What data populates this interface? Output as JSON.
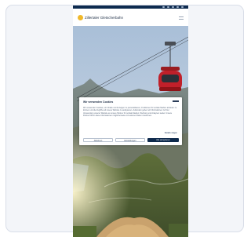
{
  "site": {
    "logo_text": "Zillertaler Gletscherbahn"
  },
  "header": {
    "menu_icon": "hamburger-menu-icon",
    "top_icons": [
      "social-icon",
      "social-icon",
      "social-icon",
      "social-icon",
      "language-icon"
    ]
  },
  "hero": {
    "image": "cable-car-mountain-landscape",
    "cable_car_color": "#c0202a"
  },
  "cookie_banner": {
    "title": "Wir verwenden Cookies",
    "body": "Wir verwenden Cookies, um Inhalte und Anzeigen zu personalisieren, Funktionen für soziale Medien anbieten zu können und die Zugriffe auf unsere Website zu analysieren. Außerdem geben wir Informationen zu Ihrer Verwendung unserer Website an unsere Partner für soziale Medien, Werbung und Analysen weiter. Unsere Partner führen diese Informationen möglicherweise mit weiteren Daten zusammen.",
    "details_link": "Details zeigen",
    "buttons": {
      "decline": "Ablehnen",
      "settings": "Einstellungen",
      "accept": "Alle akzeptieren"
    }
  },
  "colors": {
    "brand_navy": "#0e2a4c",
    "brand_yellow": "#f0b82a"
  }
}
